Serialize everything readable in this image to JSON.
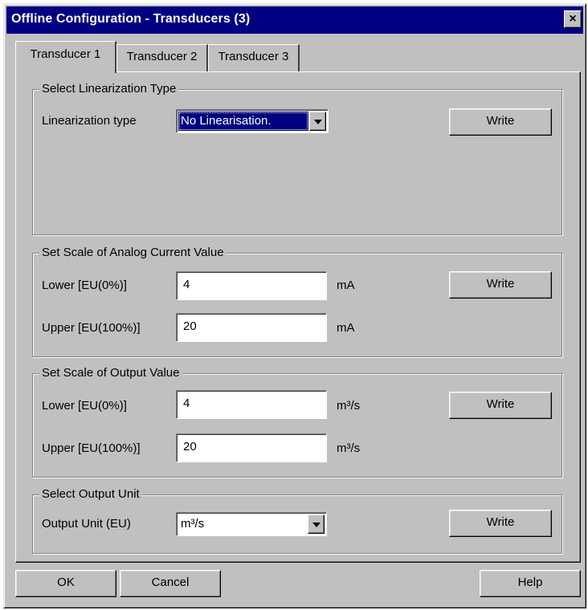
{
  "window": {
    "title": "Offline Configuration - Transducers (3)",
    "close_label": "×"
  },
  "tabs": [
    {
      "label": "Transducer 1",
      "active": true
    },
    {
      "label": "Transducer 2",
      "active": false
    },
    {
      "label": "Transducer 3",
      "active": false
    }
  ],
  "linearization": {
    "group_title": "Select Linearization Type",
    "label": "Linearization type",
    "selected_value": "No Linearisation.",
    "write_label": "Write"
  },
  "analog_scale": {
    "group_title": "Set Scale of Analog Current Value",
    "lower_label": "Lower [EU(0%)]",
    "lower_value": "4",
    "lower_unit": "mA",
    "upper_label": "Upper [EU(100%)]",
    "upper_value": "20",
    "upper_unit": "mA",
    "write_label": "Write"
  },
  "output_scale": {
    "group_title": "Set Scale of Output Value",
    "lower_label": "Lower [EU(0%)]",
    "lower_value": "4",
    "lower_unit": "m³/s",
    "upper_label": "Upper [EU(100%)]",
    "upper_value": "20",
    "upper_unit": "m³/s",
    "write_label": "Write"
  },
  "output_unit": {
    "group_title": "Select Output Unit",
    "label": "Output Unit (EU)",
    "selected_value": "m³/s",
    "write_label": "Write"
  },
  "footer": {
    "ok_label": "OK",
    "cancel_label": "Cancel",
    "help_label": "Help"
  },
  "colors": {
    "face": "#c0c0c0",
    "titlebar": "#000080",
    "selection": "#000080"
  }
}
